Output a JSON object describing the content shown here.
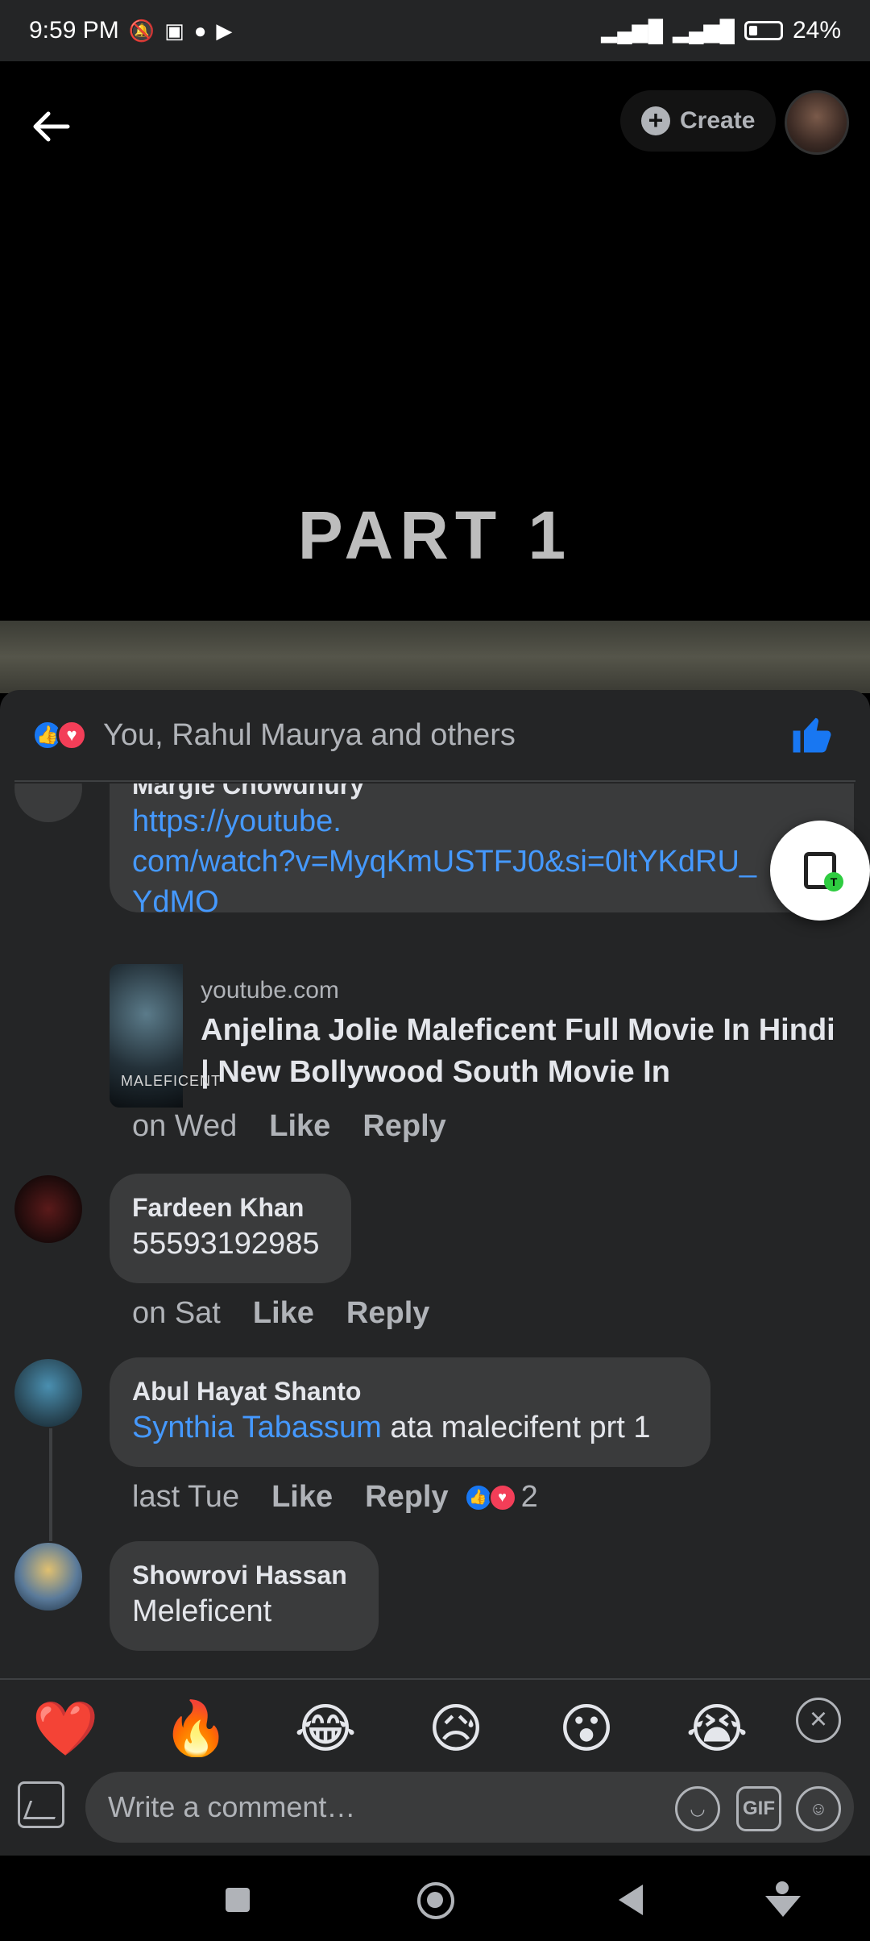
{
  "status_bar": {
    "time": "9:59 PM",
    "battery": "24%"
  },
  "header": {
    "create_label": "Create"
  },
  "video": {
    "title": "PART  1"
  },
  "reactions": {
    "summary": "You, Rahul Maurya and others"
  },
  "comments": [
    {
      "name": "Margie Chowdhury",
      "text": "https://youtube.\ncom/watch?v=MyqKmUSTFJ0&si=0ltYKdRU_\nYdMO",
      "time": "on Wed",
      "like": "Like",
      "reply": "Reply",
      "preview": {
        "domain": "youtube.com",
        "title": "Anjelina Jolie Maleficent Full Movie In Hindi | New Bollywood South Movie In"
      }
    },
    {
      "name": "Fardeen Khan",
      "text": "55593192985",
      "time": "on Sat",
      "like": "Like",
      "reply": "Reply"
    },
    {
      "name": "Abul Hayat Shanto",
      "mention": "Synthia Tabassum",
      "text": " ata malecifent prt 1",
      "time": "last Tue",
      "like": "Like",
      "reply": "Reply",
      "reaction_count": "2"
    },
    {
      "name": "Showrovi Hassan",
      "text": "Meleficent"
    }
  ],
  "emoji_reactions": [
    "❤️",
    "🔥",
    "😂",
    "😥",
    "😮",
    "😭"
  ],
  "composer": {
    "placeholder": "Write a comment…",
    "gif_label": "GIF"
  },
  "icons": {
    "back": "arrow-left-icon",
    "create": "plus-circle-icon",
    "like": "thumbs-up-icon",
    "clipboard": "clipboard-icon",
    "close": "close-circle-icon",
    "photo": "photo-icon",
    "sticker": "sticker-icon",
    "emoji": "smiley-icon"
  }
}
